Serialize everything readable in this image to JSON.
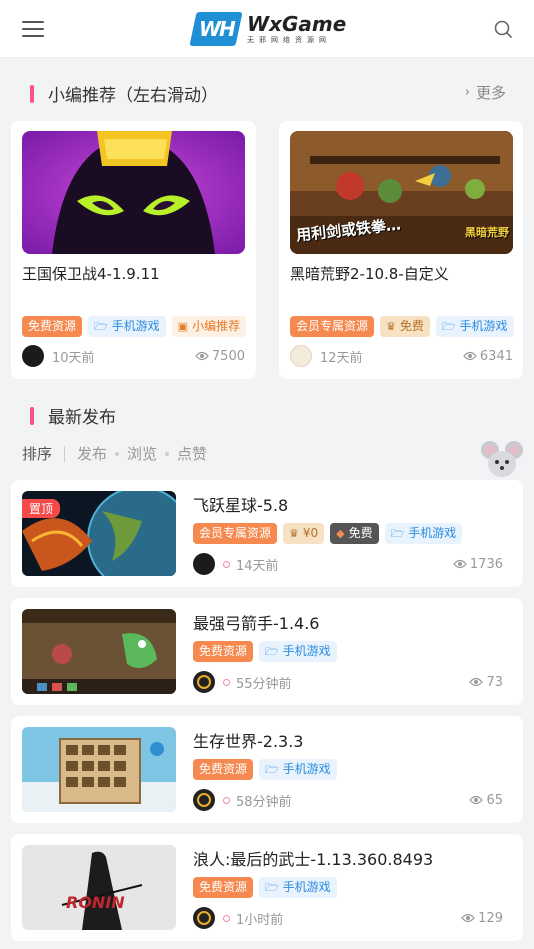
{
  "header": {
    "logo_mark": "WH",
    "logo_name": "WxGame",
    "logo_sub": "无邪网络资源网"
  },
  "featured": {
    "title": "小编推荐（左右滑动）",
    "more": "更多",
    "cards": [
      {
        "title": "王国保卫战4-1.9.11",
        "tags": [
          {
            "label": "免费资源",
            "kind": "free"
          },
          {
            "label": "手机游戏",
            "kind": "cat",
            "icon": "folder-icon"
          },
          {
            "label": "小编推荐",
            "kind": "pick",
            "icon": "box-icon"
          }
        ],
        "time": "10天前",
        "views": "7500"
      },
      {
        "title": "黑暗荒野2-10.8-自定义",
        "thumb_caption": "用利剑或铁拳…",
        "thumb_logo": "黑暗荒野",
        "tags": [
          {
            "label": "会员专属资源",
            "kind": "member"
          },
          {
            "label": "免费",
            "kind": "cost",
            "icon": "crown-icon"
          },
          {
            "label": "手机游戏",
            "kind": "cat",
            "icon": "folder-icon"
          }
        ],
        "time": "12天前",
        "views": "6341"
      }
    ]
  },
  "latest": {
    "title": "最新发布",
    "sort_label": "排序",
    "sort_options": [
      "发布",
      "浏览",
      "点赞"
    ],
    "posts": [
      {
        "title": "飞跃星球-5.8",
        "pinned": "置顶",
        "tags": [
          {
            "label": "会员专属资源",
            "kind": "member"
          },
          {
            "label": "¥0",
            "kind": "cost",
            "icon": "crown-icon"
          },
          {
            "label": "免费",
            "kind": "dark",
            "icon": "diamond-icon"
          },
          {
            "label": "手机游戏",
            "kind": "cat",
            "icon": "folder-icon"
          }
        ],
        "time": "14天前",
        "views": "1736"
      },
      {
        "title": "最强弓箭手-1.4.6",
        "tags": [
          {
            "label": "免费资源",
            "kind": "free"
          },
          {
            "label": "手机游戏",
            "kind": "cat",
            "icon": "folder-icon"
          }
        ],
        "time": "55分钟前",
        "views": "73"
      },
      {
        "title": "生存世界-2.3.3",
        "tags": [
          {
            "label": "免费资源",
            "kind": "free"
          },
          {
            "label": "手机游戏",
            "kind": "cat",
            "icon": "folder-icon"
          }
        ],
        "time": "58分钟前",
        "views": "65"
      },
      {
        "title": "浪人:最后的武士-1.13.360.8493",
        "thumb_logo": "RONIN",
        "tags": [
          {
            "label": "免费资源",
            "kind": "free"
          },
          {
            "label": "手机游戏",
            "kind": "cat",
            "icon": "folder-icon"
          }
        ],
        "time": "1小时前",
        "views": "129"
      }
    ]
  }
}
